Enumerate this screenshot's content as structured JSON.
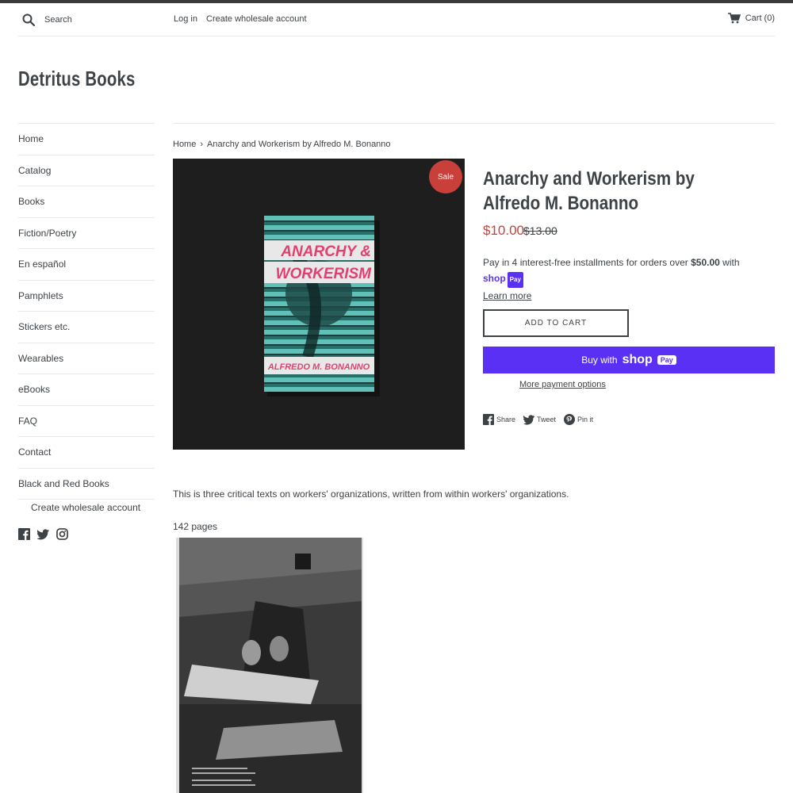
{
  "header": {
    "search_placeholder": "Search",
    "login_label": "Log in",
    "create_account_label": "Create wholesale account",
    "cart_label": "Cart (0)"
  },
  "site": {
    "title": "Detritus Books"
  },
  "sidebar": {
    "items": [
      {
        "label": "Home"
      },
      {
        "label": "Catalog"
      },
      {
        "label": "Books"
      },
      {
        "label": "Fiction/Poetry"
      },
      {
        "label": "En español"
      },
      {
        "label": "Pamphlets"
      },
      {
        "label": "Stickers etc."
      },
      {
        "label": "Wearables"
      },
      {
        "label": "eBooks"
      },
      {
        "label": "FAQ"
      },
      {
        "label": "Contact"
      },
      {
        "label": "Black and Red Books"
      }
    ],
    "sub_item": "Create wholesale account",
    "social_icons": [
      "facebook-icon",
      "twitter-icon",
      "instagram-icon"
    ]
  },
  "breadcrumb": {
    "home": "Home",
    "separator": "›",
    "current": "Anarchy and Workerism by Alfredo M. Bonanno"
  },
  "product": {
    "sale_badge": "Sale",
    "title": "Anarchy and Workerism by Alfredo M. Bonanno",
    "sale_price": "$10.00",
    "regular_price": "$13.00",
    "installments_text": "Pay in 4 interest-free installments for orders over ",
    "installments_threshold": "$50.00",
    "installments_with": " with ",
    "shop_brand": "shop",
    "shop_pay_badge": "Pay",
    "learn_more": "Learn more",
    "add_to_cart": "ADD TO CART",
    "buy_with": "Buy with",
    "more_payment_options": "More payment options",
    "share": "Share",
    "tweet": "Tweet",
    "pin": "Pin it",
    "cover_title_line1": "ANARCHY &",
    "cover_title_line2": "WORKERISM",
    "cover_author": "ALFREDO M. BONANNO",
    "description": "This is three critical texts on workers' organizations, written from within workers' organizations.",
    "pages": "142 pages"
  },
  "colors": {
    "accent_sale": "#c9403a",
    "shop_pay": "#5a31f4",
    "text": "#3d4246",
    "cover_teal": "#2f8f8a",
    "cover_pink": "#e0406f"
  }
}
